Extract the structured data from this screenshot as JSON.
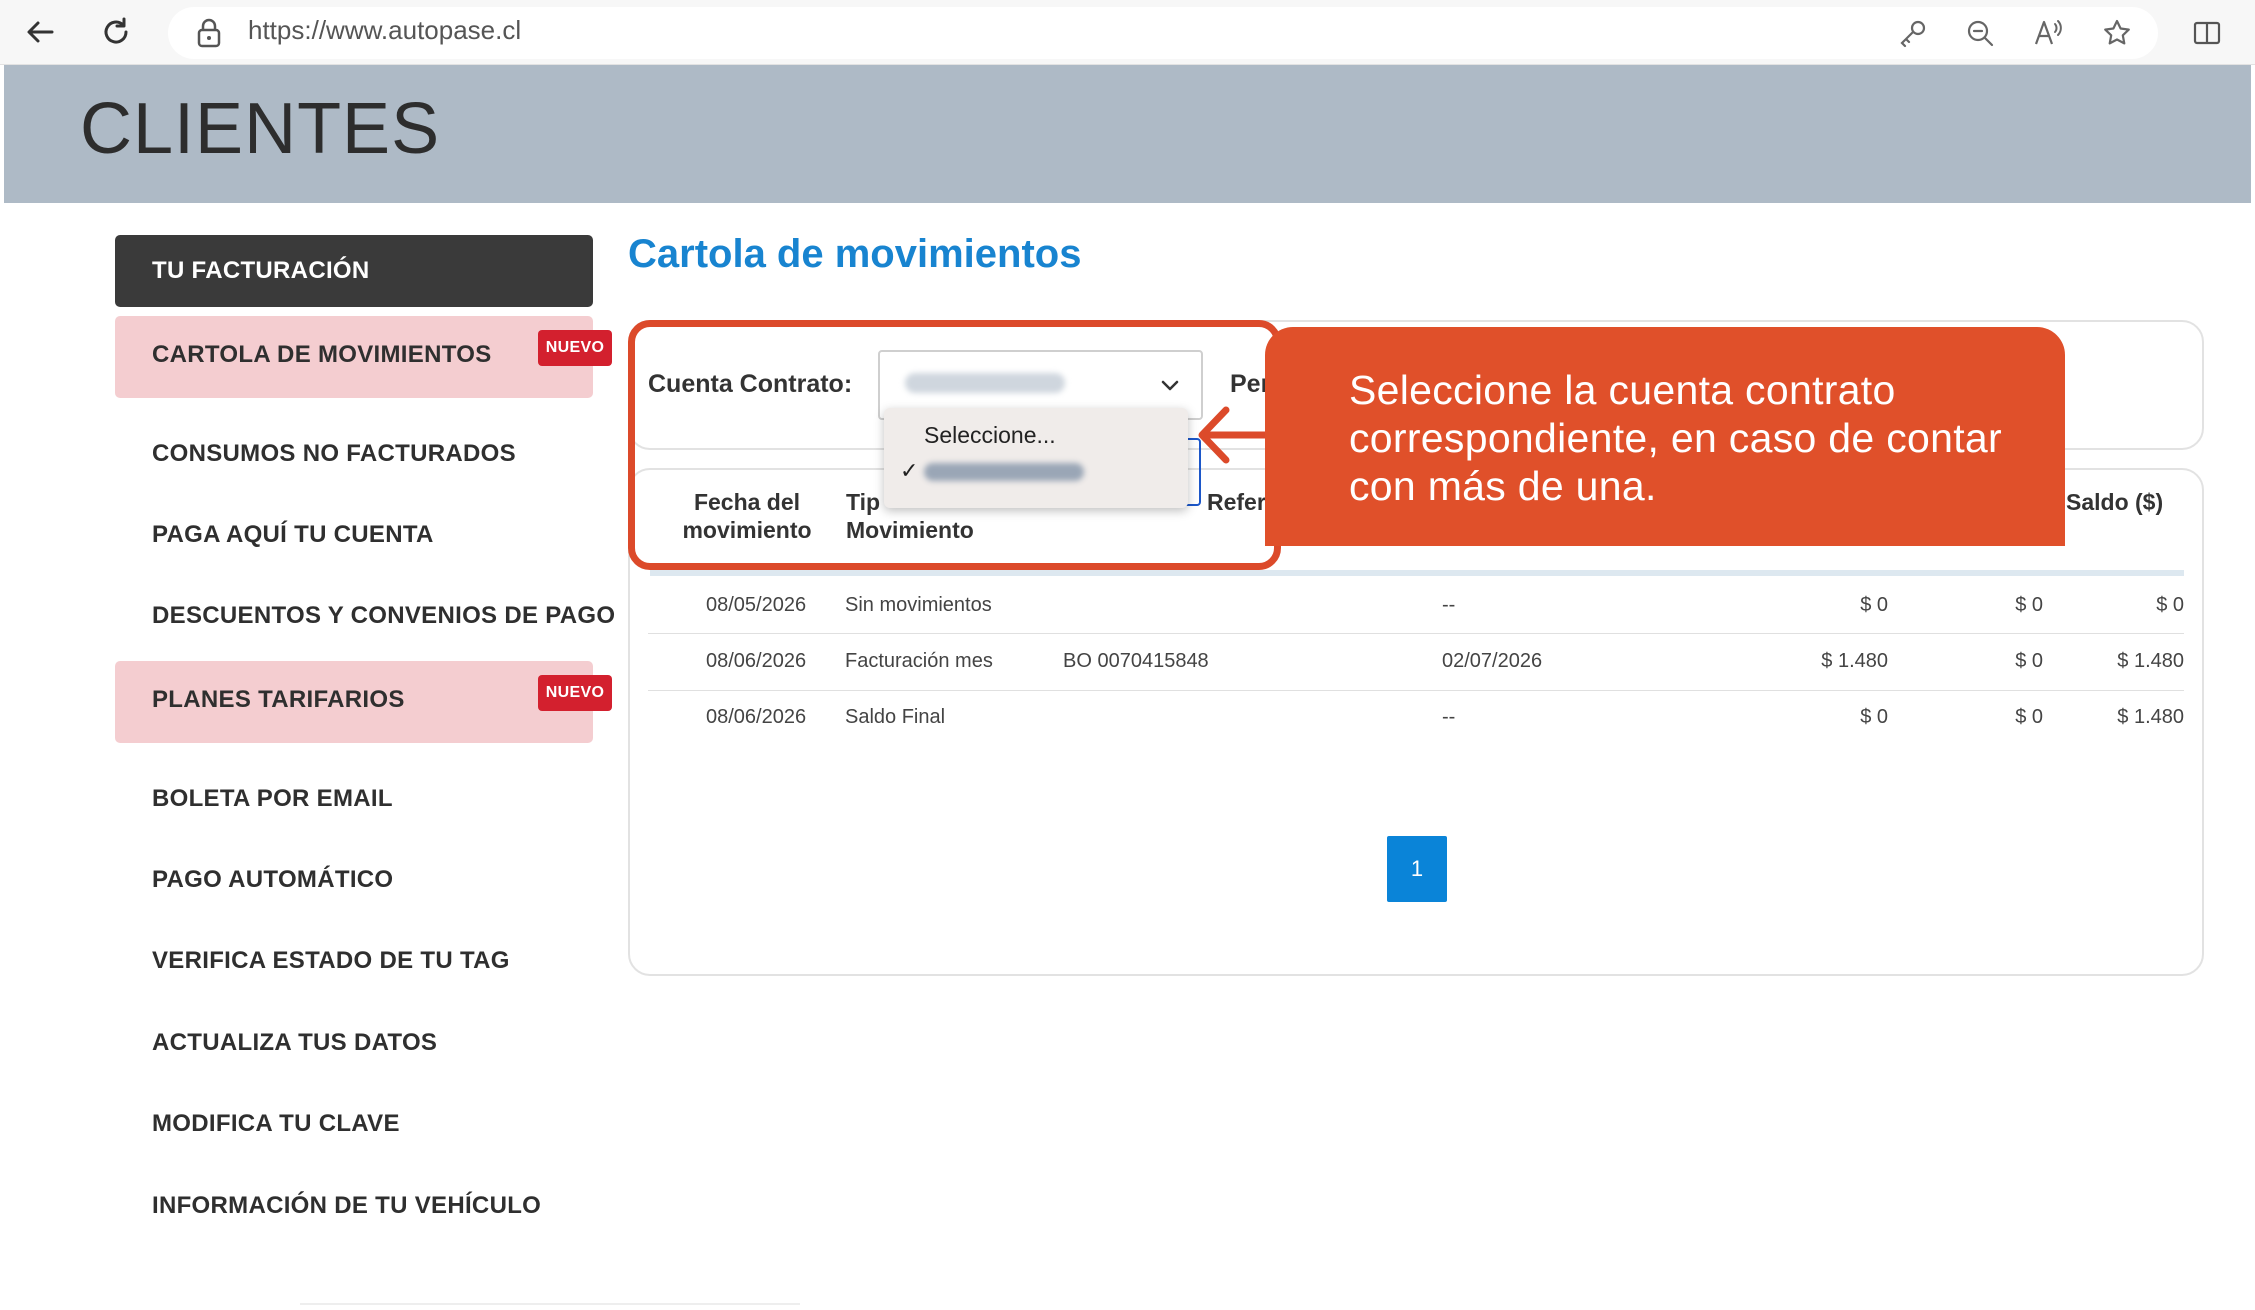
{
  "browser": {
    "url": "https://www.autopase.cl",
    "back_icon": "arrow-left-icon",
    "reload_icon": "reload-icon"
  },
  "header": {
    "title": "CLIENTES"
  },
  "sidebar": {
    "items": [
      {
        "label": "TU FACTURACIÓN"
      },
      {
        "label": "CARTOLA DE MOVIMIENTOS",
        "badge": "NUEVO"
      },
      {
        "label": "CONSUMOS NO FACTURADOS"
      },
      {
        "label": "PAGA AQUÍ TU CUENTA"
      },
      {
        "label": "DESCUENTOS Y CONVENIOS DE PAGO"
      },
      {
        "label": "PLANES TARIFARIOS",
        "badge": "NUEVO"
      },
      {
        "label": "BOLETA POR EMAIL"
      },
      {
        "label": "PAGO AUTOMÁTICO"
      },
      {
        "label": "VERIFICA ESTADO DE TU TAG"
      },
      {
        "label": "ACTUALIZA TUS DATOS"
      },
      {
        "label": "MODIFICA TU CLAVE"
      },
      {
        "label": "INFORMACIÓN DE TU VEHÍCULO"
      }
    ]
  },
  "main": {
    "title": "Cartola de movimientos",
    "filter": {
      "contract_label": "Cuenta Contrato:",
      "period_label": "Per",
      "dropdown_options": [
        "Seleccione...",
        "✓"
      ]
    },
    "table": {
      "headers": {
        "fecha": "Fecha del movimiento",
        "tipo": "Tip Movimiento",
        "referencia": "Refer",
        "saldo": "Saldo ($)"
      },
      "rows": [
        [
          "08/05/2026",
          "Sin movimientos",
          "",
          "--",
          "$ 0",
          "$ 0",
          "$ 0"
        ],
        [
          "08/06/2026",
          "Facturación mes",
          "BO 0070415848",
          "02/07/2026",
          "$ 1.480",
          "$ 0",
          "$ 1.480"
        ],
        [
          "08/06/2026",
          "Saldo Final",
          "",
          "--",
          "$ 0",
          "$ 0",
          "$ 1.480"
        ]
      ]
    },
    "pagination": {
      "current": "1"
    }
  },
  "callout": {
    "text": "Seleccione la cuenta contrato correspondiente, en caso de contar con más de una."
  },
  "colors": {
    "accent_blue": "#1884d0",
    "callout_orange": "#e0502a",
    "badge_red": "#d3202e",
    "header_gray": "#aebac6"
  }
}
